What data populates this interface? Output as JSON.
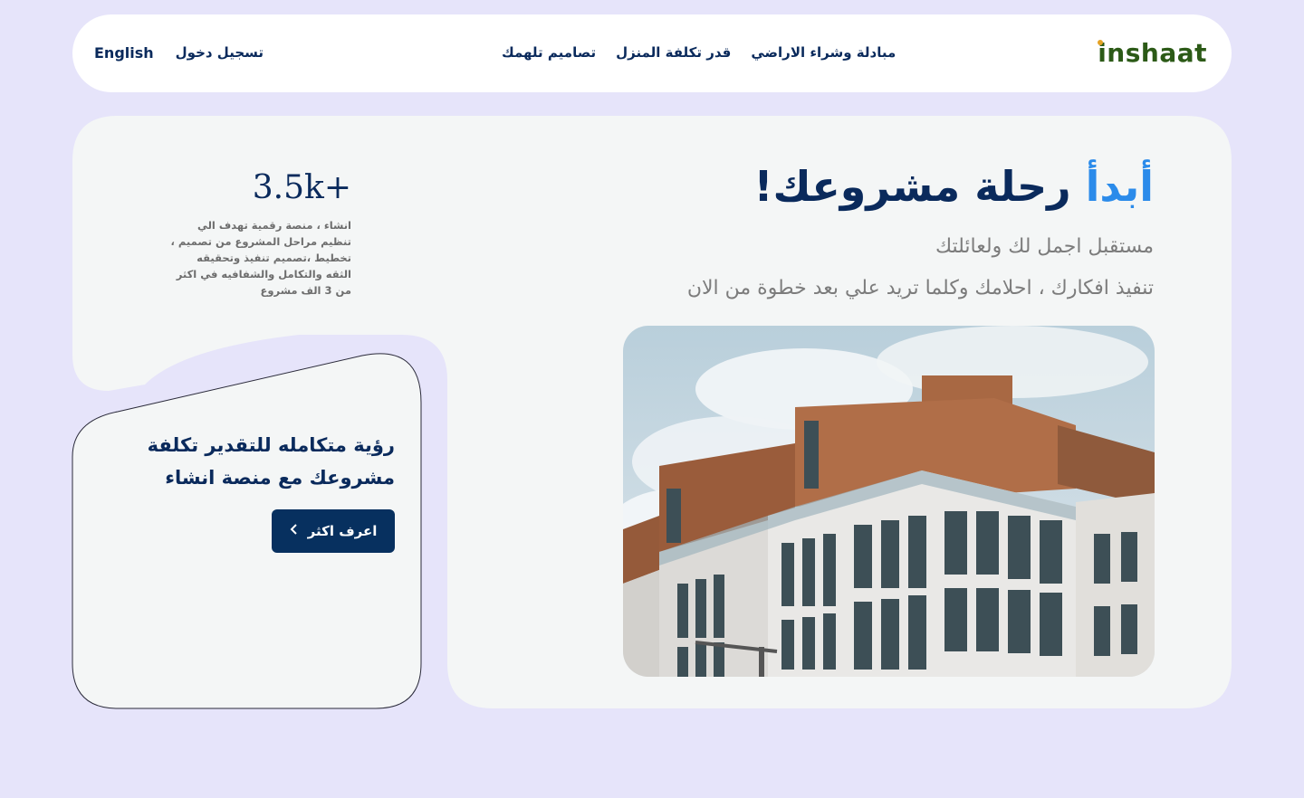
{
  "navbar": {
    "logo": "inshaat",
    "links": [
      "تصاميم تلهمك",
      "قدر تكلفة المنزل",
      "مبادلة وشراء الاراضي"
    ],
    "login_label": "تسجيل دخول",
    "language_label": "English"
  },
  "hero": {
    "title_accent": "أبدأ",
    "title_main": "رحلة مشروعك!",
    "subtitle_line1": "مستقبل اجمل لك ولعائلتك",
    "subtitle_line2": "تنفيذ افكارك ، احلامك وكلما تريد علي بعد خطوة من الان"
  },
  "stats": {
    "number": "3.5k+",
    "description": "انشاء ، منصة رقمية تهدف الي تنظيم مراحل المشروع من تصميم ، تخطيط ،تصميم تنفيذ وتحقيقه الثقه والتكامل والشفافيه في اكثر من 3 الف مشروع"
  },
  "card": {
    "title": "رؤية متكامله للتقدير تكلفة مشروعك مع منصة انشاء",
    "cta_label": "اعرف اكثر"
  },
  "colors": {
    "background": "#e6e4fa",
    "panel": "#f4f6f6",
    "primary": "#0a2a5c",
    "accent": "#2b8bea",
    "logo": "#2c5a17"
  }
}
